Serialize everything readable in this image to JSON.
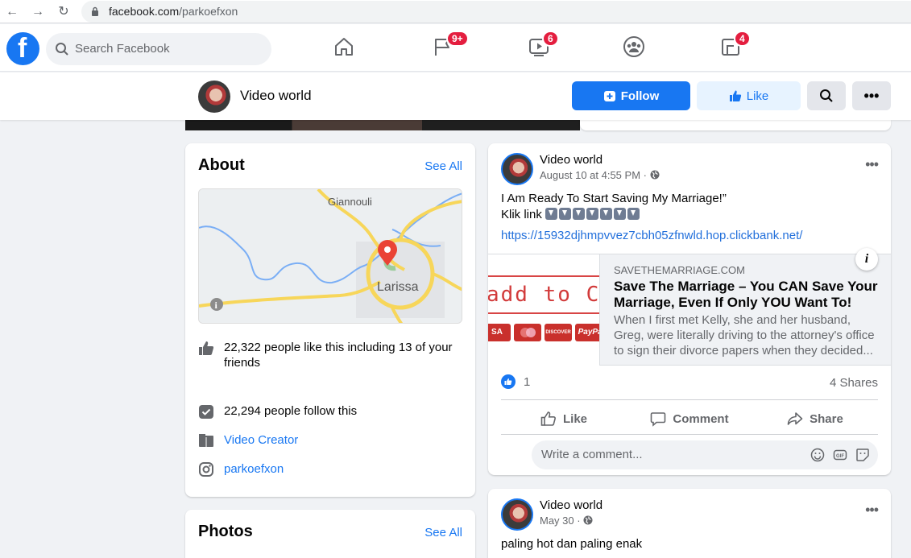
{
  "browser": {
    "url_host": "facebook.com",
    "url_path": "/parkoefxon"
  },
  "topbar": {
    "logo": "f",
    "search_placeholder": "Search Facebook",
    "nav": [
      {
        "icon": "home-icon",
        "badge": ""
      },
      {
        "icon": "flag-icon",
        "badge": "9+"
      },
      {
        "icon": "watch-icon",
        "badge": "6"
      },
      {
        "icon": "groups-icon",
        "badge": ""
      },
      {
        "icon": "gaming-icon",
        "badge": "4"
      }
    ]
  },
  "page": {
    "name": "Video world",
    "follow_label": "Follow",
    "like_label": "Like"
  },
  "about": {
    "title": "About",
    "see_all": "See All",
    "map_labels": {
      "village": "Giannouli",
      "city": "Larissa"
    },
    "likes_text": "22,322 people like this including 13 of your friends",
    "follows_text": "22,294 people follow this",
    "category": "Video Creator",
    "instagram": "parkoefxon"
  },
  "photos": {
    "title": "Photos",
    "see_all": "See All"
  },
  "post1": {
    "author": "Video world",
    "date": "August 10 at 4:55 PM ·",
    "text_line1": "I Am Ready To Start Saving My Marriage!”",
    "text_line2": "Klik link",
    "arrow_count": 7,
    "link": "https://15932djhmpvvez7cbh05zfnwld.hop.clickbank.net/",
    "card": {
      "image_text": "dd to CAR",
      "image_prefix": "a",
      "cards": [
        "SA",
        "",
        "DISCOVER",
        "PayPal"
      ],
      "domain": "SAVETHEMARRIAGE.COM",
      "title": "Save The Marriage – You CAN Save Your Marriage, Even If Only YOU Want To!",
      "description": "When I first met Kelly, she and her husband, Greg, were literally driving to the attorney's office to sign their divorce papers when they decided..."
    },
    "reactions": "1",
    "shares": "4 Shares",
    "actions": {
      "like": "Like",
      "comment": "Comment",
      "share": "Share"
    },
    "comment_placeholder": "Write a comment..."
  },
  "post2": {
    "author": "Video world",
    "date": "May 30 ·",
    "text": "paling hot dan paling enak"
  },
  "colors": {
    "brand": "#1877f2",
    "badge": "#e41e3f",
    "page_bg": "#f0f2f5"
  }
}
